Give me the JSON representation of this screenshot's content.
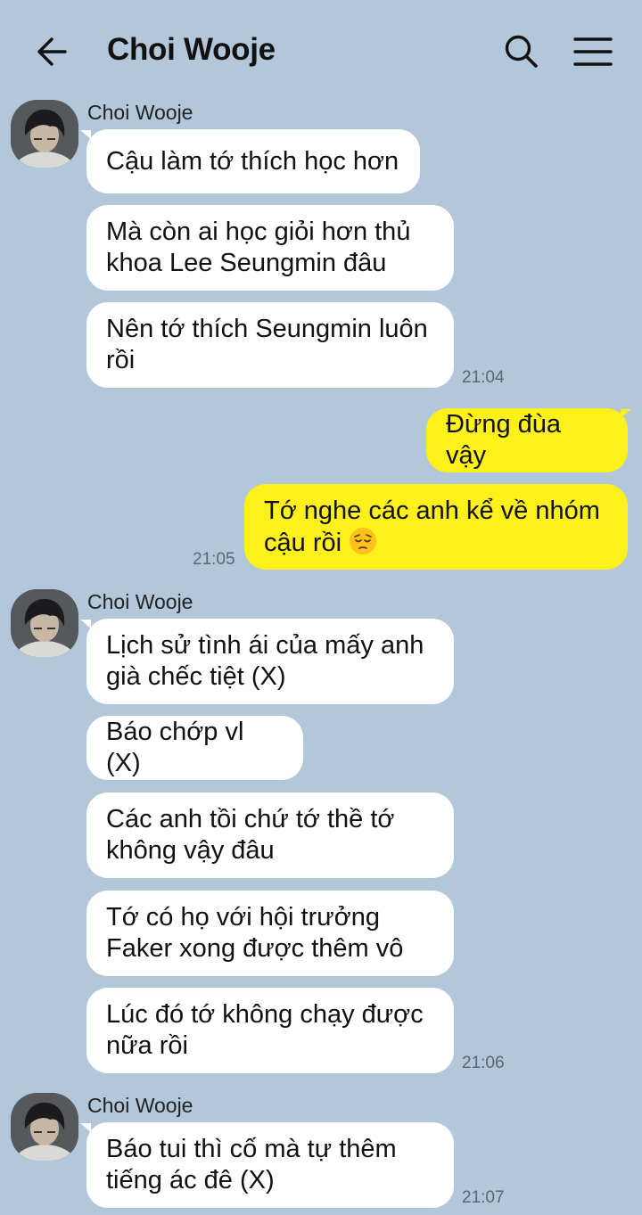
{
  "header": {
    "title": "Choi Wooje",
    "back_icon": "arrow-left-icon",
    "search_icon": "search-icon",
    "menu_icon": "hamburger-menu-icon"
  },
  "colors": {
    "background": "#b2c7da",
    "incoming_bubble": "#ffffff",
    "outgoing_bubble": "#fef01b",
    "timestamp": "#5c6670"
  },
  "groups": [
    {
      "sender": "Choi Wooje",
      "messages": [
        "Cậu làm tớ thích học hơn",
        "Mà còn ai học giỏi hơn thủ khoa Lee Seungmin đâu",
        "Nên tớ thích Seungmin luôn rồi"
      ],
      "time": "21:04"
    },
    {
      "sender": "me",
      "messages": [
        "Đừng đùa vậy",
        "Tớ nghe các anh kể về nhóm cậu rồi"
      ],
      "emoji": "pensive-face-emoji",
      "time": "21:05"
    },
    {
      "sender": "Choi Wooje",
      "messages": [
        "Lịch sử tình ái của mấy anh già chếc tiệt (X)",
        "Báo chớp vl (X)",
        "Các anh tồi chứ tớ thề tớ không vậy đâu",
        "Tớ có họ với hội trưởng Faker xong được thêm vô",
        "Lúc đó tớ không chạy được nữa rồi"
      ],
      "time": "21:06"
    },
    {
      "sender": "Choi Wooje",
      "messages": [
        "Báo tui thì cố mà tự thêm tiếng ác đê (X)"
      ],
      "time": "21:07"
    }
  ]
}
